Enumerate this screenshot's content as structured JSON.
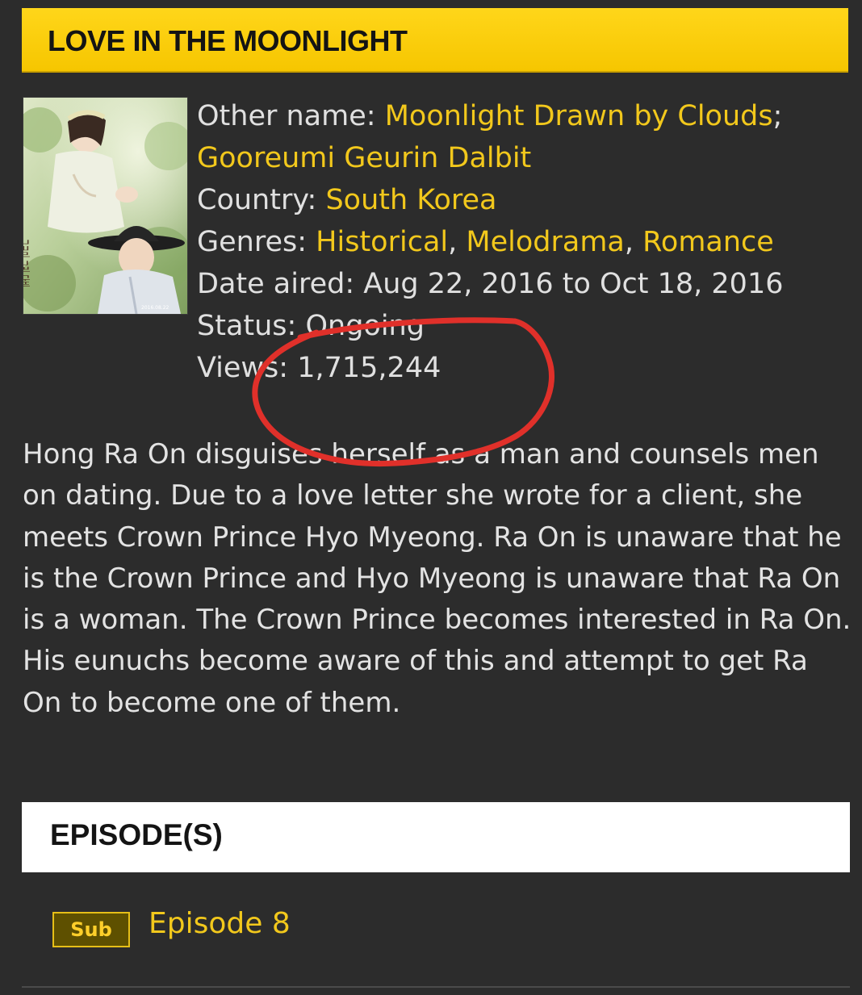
{
  "title": "LOVE IN THE MOONLIGHT",
  "poster": {
    "calligraphy": "구르미 그린 달빛",
    "date_stamp": "2016.08.22"
  },
  "info": {
    "other_name_label": "Other name:",
    "other_name_1": "Moonlight Drawn by Clouds",
    "separator_semicolon": ";",
    "other_name_2": "Gooreumi Geurin Dalbit",
    "country_label": "Country:",
    "country": "South Korea",
    "genres_label": "Genres:",
    "genre_1": "Historical",
    "genre_2": "Melodrama",
    "genre_3": "Romance",
    "comma": ",",
    "date_aired_label": "Date aired:",
    "date_aired": "Aug 22, 2016 to Oct 18, 2016",
    "status_label": "Status:",
    "status": "Ongoing",
    "views_label": "Views:",
    "views": "1,715,244"
  },
  "description": "Hong Ra On disguises herself as a man and counsels men on dating. Due to a love letter she wrote for a client, she meets Crown Prince Hyo Myeong. Ra On is unaware that he is the Crown Prince and Hyo Myeong is unaware that Ra On is a woman. The Crown Prince becomes interested in Ra On. His eunuchs become aware of this and attempt to get Ra On to become one of them.",
  "episodes": {
    "header": "EPISODE(S)",
    "items": [
      {
        "badge": "Sub",
        "label": "Episode 8"
      }
    ]
  },
  "colors": {
    "background": "#2c2c2c",
    "accent_yellow": "#f2c81c",
    "title_bar": "#ffd61a",
    "annotation_red": "#e0302a"
  },
  "annotation": {
    "type": "hand-drawn-circle",
    "target": "views"
  }
}
